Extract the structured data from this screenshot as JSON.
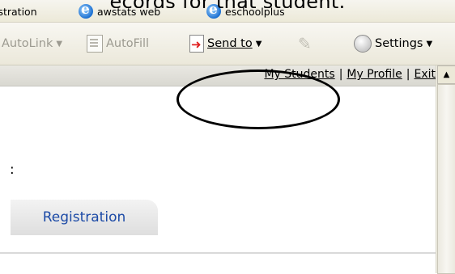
{
  "caption_text": "ecords for that student.",
  "links_bar": {
    "items": [
      {
        "label": "istration",
        "icon": "ie-icon"
      },
      {
        "label": "awstats web",
        "icon": "ie-icon"
      },
      {
        "label": "eschoolplus",
        "icon": "ie-icon"
      }
    ]
  },
  "toolbar": {
    "autolink_label": "AutoLink",
    "autofill_label": "AutoFill",
    "sendto_label": "Send to",
    "settings_label": "Settings"
  },
  "header_links": {
    "my_students": "My Students",
    "my_profile": "My Profile",
    "exit": "Exit",
    "separator": "|"
  },
  "page": {
    "label_fragment": ":",
    "tab_label": "Registration"
  }
}
